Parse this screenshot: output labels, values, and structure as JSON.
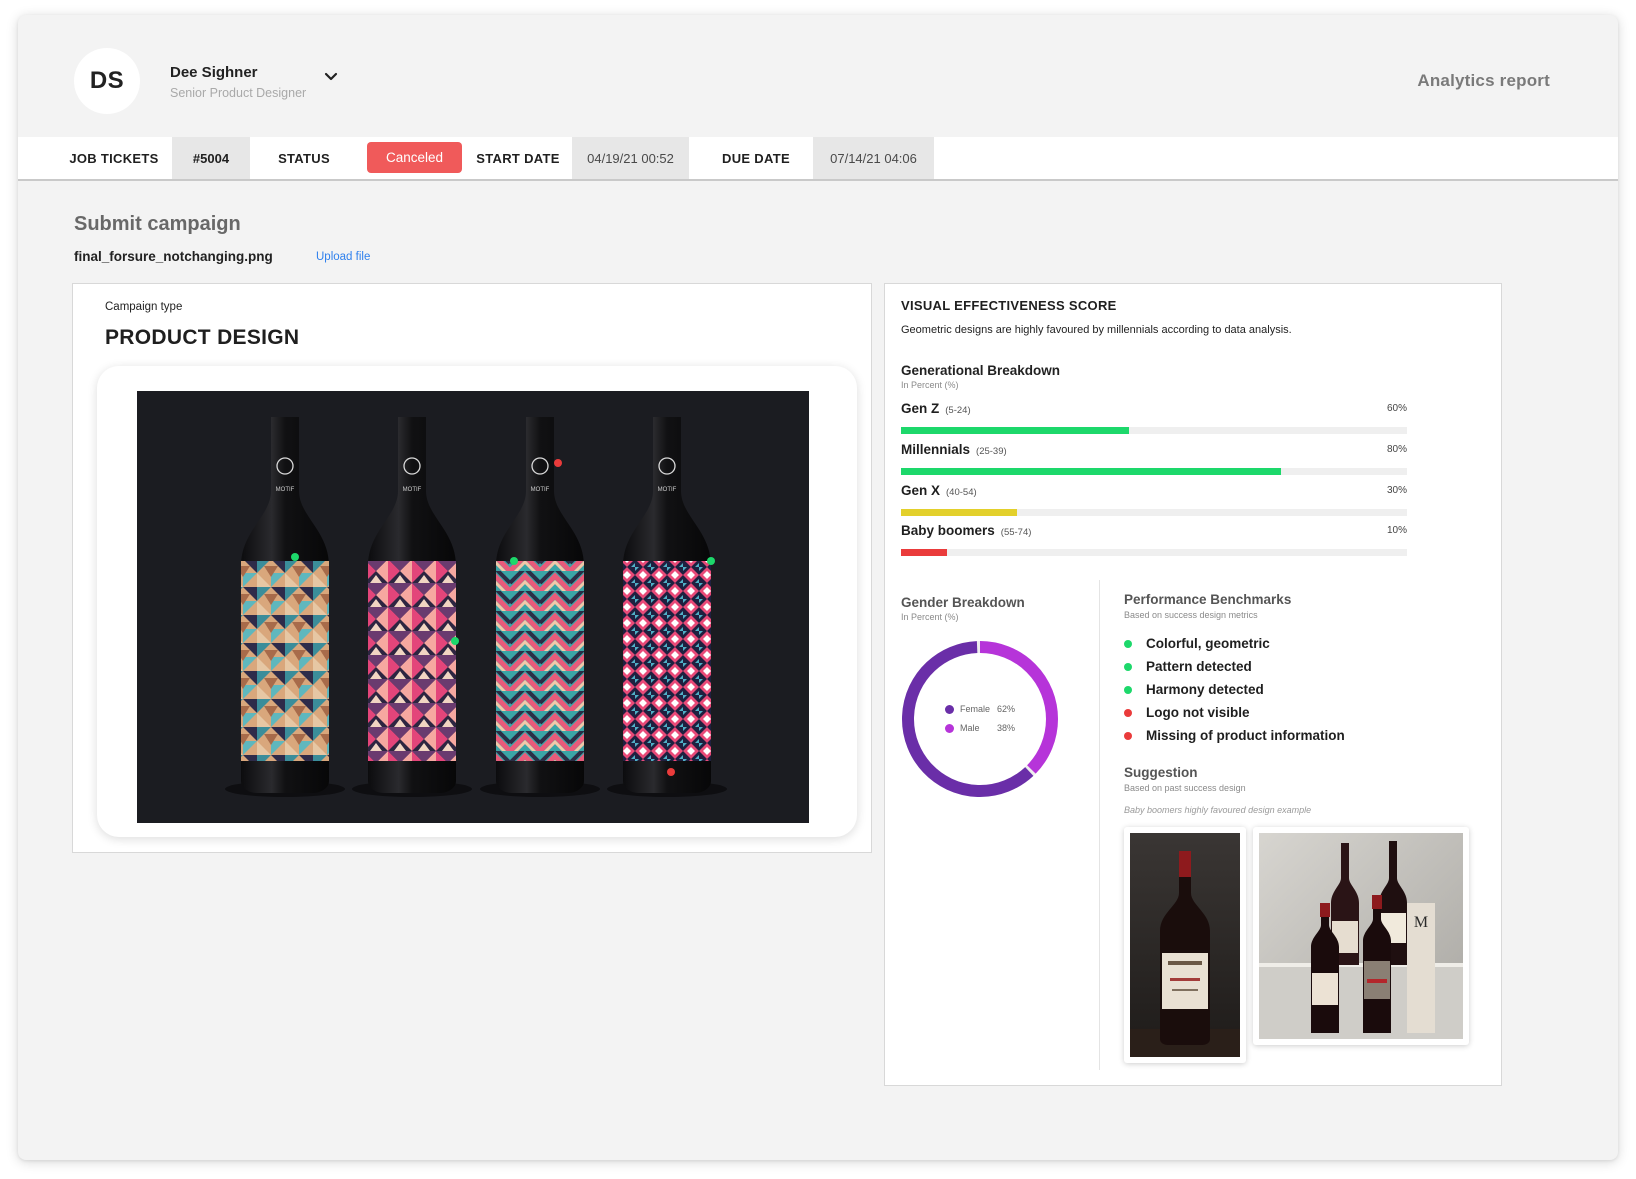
{
  "header": {
    "avatar_initials": "DS",
    "user_name": "Dee Sighner",
    "user_role": "Senior Product Designer",
    "report_title": "Analytics report"
  },
  "ticket_bar": {
    "job_tickets_label": "JOB TICKETS",
    "ticket_number": "#5004",
    "status_label": "STATUS",
    "status_value": "Canceled",
    "start_date_label": "START DATE",
    "start_date_value": "04/19/21 00:52",
    "due_date_label": "DUE DATE",
    "due_date_value": "07/14/21 04:06"
  },
  "submit": {
    "title": "Submit campaign",
    "file_name": "final_forsure_notchanging.png",
    "upload_label": "Upload file"
  },
  "campaign": {
    "type_label": "Campaign type",
    "type_value": "PRODUCT DESIGN",
    "bottle_brand": "MOTIF"
  },
  "effectiveness": {
    "title": "VISUAL EFFECTIVENESS SCORE",
    "description": "Geometric designs are highly favoured by millennials according to data analysis.",
    "generational": {
      "title": "Generational Breakdown",
      "subtitle": "In Percent (%)",
      "rows": [
        {
          "name": "Gen Z",
          "range": "(5-24)",
          "pct_label": "60%",
          "fill": 0.45,
          "color": "#1dd86b"
        },
        {
          "name": "Millennials",
          "range": "(25-39)",
          "pct_label": "80%",
          "fill": 0.75,
          "color": "#1dd86b"
        },
        {
          "name": "Gen X",
          "range": "(40-54)",
          "pct_label": "30%",
          "fill": 0.23,
          "color": "#e3d02b"
        },
        {
          "name": "Baby boomers",
          "range": "(55-74)",
          "pct_label": "10%",
          "fill": 0.09,
          "color": "#ea3b3b"
        }
      ]
    },
    "gender": {
      "title": "Gender Breakdown",
      "subtitle": "In Percent (%)",
      "female_label": "Female",
      "female_pct": "62%",
      "female_value": 62,
      "female_color": "#6a2ea8",
      "male_label": "Male",
      "male_pct": "38%",
      "male_value": 38,
      "male_color": "#b634d9"
    },
    "performance": {
      "title": "Performance Benchmarks",
      "subtitle": "Based on success design metrics",
      "items": [
        {
          "label": "Colorful, geometric",
          "status": "pass",
          "color": "#1dd86b"
        },
        {
          "label": "Pattern detected",
          "status": "pass",
          "color": "#1dd86b"
        },
        {
          "label": "Harmony detected",
          "status": "pass",
          "color": "#1dd86b"
        },
        {
          "label": "Logo not visible",
          "status": "fail",
          "color": "#ea3b3b"
        },
        {
          "label": "Missing of product information",
          "status": "fail",
          "color": "#ea3b3b"
        }
      ]
    },
    "suggestion": {
      "title": "Suggestion",
      "subtitle": "Based on past success design",
      "caption": "Baby boomers highly favoured design example"
    }
  },
  "colors": {
    "status_canceled": "#f05a5a",
    "link_blue": "#2f80ed",
    "pass_green": "#1dd86b",
    "fail_red": "#ea3b3b"
  }
}
